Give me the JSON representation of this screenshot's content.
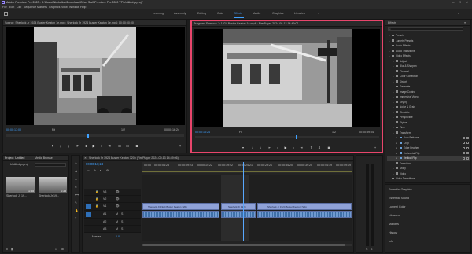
{
  "app": {
    "title": "Adobe Premiere Pro 2020 - D:\\Users\\Nimbalkar\\Download\\Other Stuff\\Premiere Pro 2020 VP\\Untitled.prproj *",
    "menu": [
      "File",
      "Edit",
      "Clip",
      "Sequence",
      "Markers",
      "Graphics",
      "View",
      "Window",
      "Help"
    ],
    "workspaces": [
      {
        "label": "Learning",
        "active": false
      },
      {
        "label": "Assembly",
        "active": false
      },
      {
        "label": "Editing",
        "active": false
      },
      {
        "label": "Color",
        "active": false
      },
      {
        "label": "Effects",
        "active": true
      },
      {
        "label": "Audio",
        "active": false
      },
      {
        "label": "Graphics",
        "active": false
      },
      {
        "label": "Libraries",
        "active": false
      }
    ]
  },
  "source": {
    "title": "Source: Sherlock Jr 1924 Buster Keaton 1e.mp4: Sherlock Jr 1924 Buster Keaton 1e.mp4: 00:00:00:00",
    "timecode_left": "00:00:17:00",
    "fit": "Fit",
    "fraction": "1/2",
    "timecode_right": "00:00:16;24"
  },
  "program": {
    "title": "Program: Sherlock Jr 1924 Buster Keaton 1e.mp4 · FirePlayer 2024-09-13 14:49:06",
    "timecode_left": "00:00:16:24",
    "fit": "Fit",
    "fraction": "1/2",
    "timecode_right": "00:00:59:04"
  },
  "project": {
    "tabs": [
      "Project: Untitled",
      "Media Browser"
    ],
    "file": "Untitled.prproj",
    "items": [
      {
        "label": "Sherlock Jr 19...",
        "duration": "1:35"
      },
      {
        "label": "Sherlock Jr 19...",
        "duration": "1:35"
      }
    ]
  },
  "timeline": {
    "tab": "Sherlock Jr 1924 Buster Keaton 720p (FirePlayer 2024-09-13 14:49:06)",
    "timecode": "00:00:16;24",
    "ruler": [
      "00:00",
      "00:00:04:23",
      "00:00:09:23",
      "00:00:14:22",
      "00:00:19:22",
      "00:00:24:21",
      "00:00:29:21",
      "00:00:34:20",
      "00:00:39:20",
      "00:00:44:19",
      "00:00:49:19"
    ],
    "tracks": [
      "V3",
      "V2",
      "V1",
      "A1",
      "A2",
      "A3"
    ],
    "master_label": "Master",
    "master_value": "0.0",
    "clip_v1_a": "Sherlock Jr 1924 Buster Keaton 720p",
    "clip_v1_b": "Sherlock Jr 1924",
    "clip_v1_c": "Sherlock Jr 1924 Buster Keaton 720p"
  },
  "effects": {
    "title": "Effects",
    "tree": [
      {
        "label": "Presets",
        "indent": 0,
        "checks": 0
      },
      {
        "label": "Lumetri Presets",
        "indent": 0,
        "checks": 0
      },
      {
        "label": "Audio Effects",
        "indent": 0,
        "checks": 0
      },
      {
        "label": "Audio Transitions",
        "indent": 0,
        "checks": 0
      },
      {
        "label": "Video Effects",
        "indent": 0,
        "checks": 0
      },
      {
        "label": "Adjust",
        "indent": 1,
        "checks": 0
      },
      {
        "label": "Blur & Sharpen",
        "indent": 1,
        "checks": 0
      },
      {
        "label": "Channel",
        "indent": 1,
        "checks": 0
      },
      {
        "label": "Color Correction",
        "indent": 1,
        "checks": 0
      },
      {
        "label": "Distort",
        "indent": 1,
        "checks": 0
      },
      {
        "label": "Generate",
        "indent": 1,
        "checks": 0
      },
      {
        "label": "Image Control",
        "indent": 1,
        "checks": 0
      },
      {
        "label": "Immersive Video",
        "indent": 1,
        "checks": 0
      },
      {
        "label": "Keying",
        "indent": 1,
        "checks": 0
      },
      {
        "label": "Noise & Grain",
        "indent": 1,
        "checks": 0
      },
      {
        "label": "Obsolete",
        "indent": 1,
        "checks": 0
      },
      {
        "label": "Perspective",
        "indent": 1,
        "checks": 0
      },
      {
        "label": "Stylize",
        "indent": 1,
        "checks": 0
      },
      {
        "label": "Time",
        "indent": 1,
        "checks": 0
      },
      {
        "label": "Transform",
        "indent": 1,
        "checks": 0
      },
      {
        "label": "Auto Reframe",
        "indent": 2,
        "checks": 2
      },
      {
        "label": "Crop",
        "indent": 2,
        "checks": 2
      },
      {
        "label": "Edge Feather",
        "indent": 2,
        "checks": 2
      },
      {
        "label": "Horizontal Flip",
        "indent": 2,
        "checks": 2
      },
      {
        "label": "Vertical Flip",
        "indent": 2,
        "checks": 2,
        "selected": true
      },
      {
        "label": "Transition",
        "indent": 1,
        "checks": 0
      },
      {
        "label": "Utility",
        "indent": 1,
        "checks": 0
      },
      {
        "label": "Video",
        "indent": 1,
        "checks": 0
      },
      {
        "label": "Video Transitions",
        "indent": 0,
        "checks": 0
      }
    ],
    "bottom_panels": [
      "Essential Graphics",
      "Essential Sound",
      "Lumetri Color",
      "Libraries",
      "Markers",
      "History",
      "Info"
    ]
  },
  "colors": {
    "accent_blue": "#3fa1ff",
    "highlight_red": "#e8456b",
    "clip_video": "#8fa2d8",
    "clip_audio": "#3f70a8",
    "playhead": "#58a8ff"
  },
  "timeline_tools": [
    "select-tool",
    "track-select-tool",
    "ripple-edit-tool",
    "razor-tool",
    "slip-tool",
    "pen-tool",
    "hand-tool",
    "type-tool"
  ]
}
